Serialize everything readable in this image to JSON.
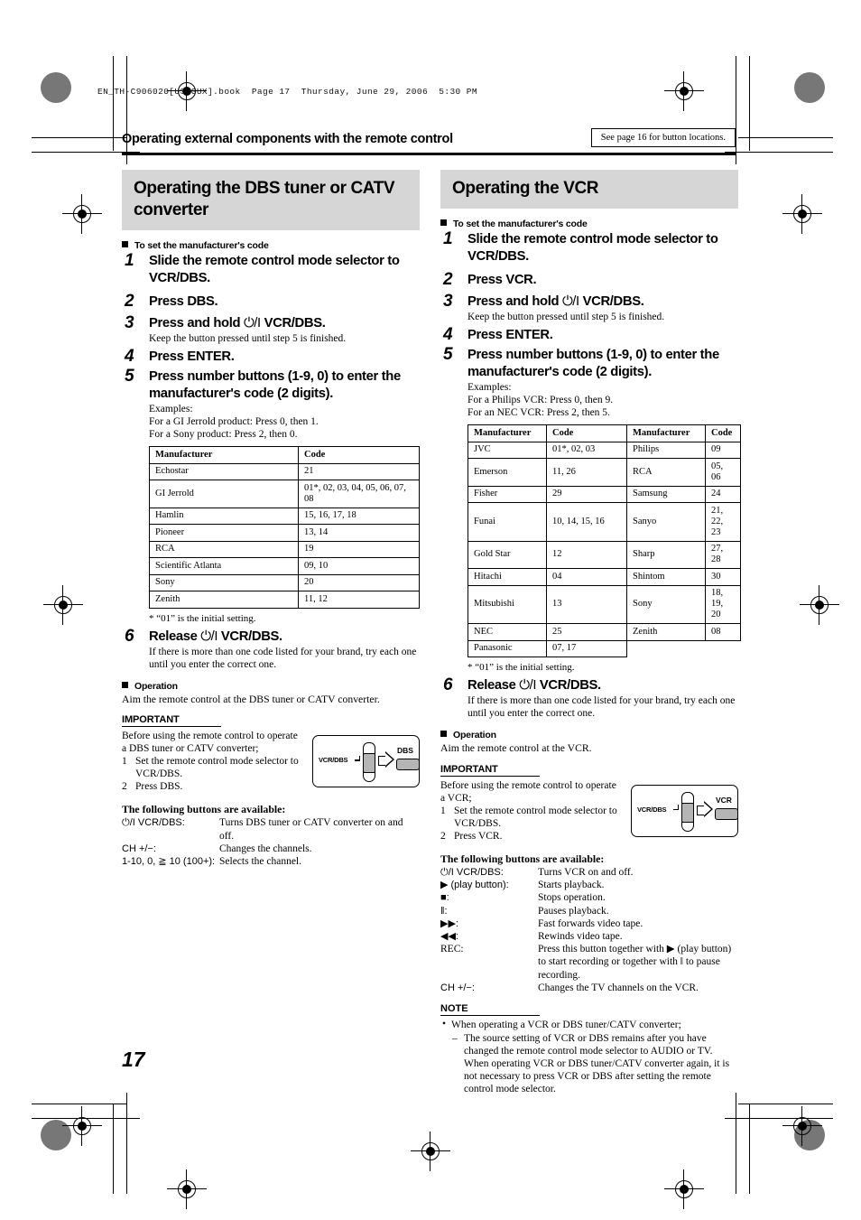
{
  "book_header": "EN_TH-C906020[USUGUX].book  Page 17  Thursday, June 29, 2006  5:30 PM",
  "running_head": {
    "title": "Operating external components with the remote control",
    "see_page_box": "See page 16 for button locations."
  },
  "page_number": "17",
  "left_column": {
    "section_title": "Operating the DBS tuner or CATV converter",
    "subhead": "To set the manufacturer's code",
    "steps": [
      {
        "num": "1",
        "title": "Slide the remote control mode selector to VCR/DBS.",
        "sub": ""
      },
      {
        "num": "2",
        "title": "Press DBS.",
        "sub": ""
      },
      {
        "num": "3",
        "title_pre": "Press and hold ",
        "power_glyph": "⏻/I",
        "title_post": " VCR/DBS.",
        "sub": "Keep the button pressed until step 5 is finished."
      },
      {
        "num": "4",
        "title": "Press ENTER.",
        "sub": ""
      },
      {
        "num": "5",
        "title": "Press number buttons (1-9, 0) to enter the manufacturer's code (2 digits).",
        "examples_label": "Examples:",
        "example_lines": [
          "For a GI Jerrold product: Press 0, then 1.",
          "For a Sony product: Press 2, then 0."
        ]
      }
    ],
    "table": {
      "headers": [
        "Manufacturer",
        "Code"
      ],
      "rows": [
        [
          "Echostar",
          "21"
        ],
        [
          "GI Jerrold",
          "01*, 02, 03, 04, 05, 06, 07, 08"
        ],
        [
          "Hamlin",
          "15, 16, 17, 18"
        ],
        [
          "Pioneer",
          "13, 14"
        ],
        [
          "RCA",
          "19"
        ],
        [
          "Scientific Atlanta",
          "09, 10"
        ],
        [
          "Sony",
          "20"
        ],
        [
          "Zenith",
          "11, 12"
        ]
      ]
    },
    "footnote": "* “01” is the initial setting.",
    "step6": {
      "num": "6",
      "title_pre": "Release ",
      "power_glyph": "⏻/I",
      "title_post": " VCR/DBS.",
      "sub": "If there is more than one code listed for your brand, try each one until you enter the correct one."
    },
    "operation_head": "Operation",
    "operation_body": "Aim the remote control at the DBS tuner or CATV converter.",
    "important_head": "IMPORTANT",
    "important_intro": "Before using the remote control to operate a DBS tuner or CATV converter;",
    "important_items": [
      {
        "n": "1",
        "t": "Set the remote control mode selector to VCR/DBS."
      },
      {
        "n": "2",
        "t": "Press DBS."
      }
    ],
    "diagram": {
      "selector_label": "VCR/DBS",
      "button_label": "DBS"
    },
    "buttons_head": "The following buttons are available:",
    "button_rows": [
      {
        "key": "⏻/I VCR/DBS:",
        "val": "Turns DBS tuner or CATV converter on and off."
      },
      {
        "key": "CH +/−:",
        "val": "Changes the channels."
      },
      {
        "key": "1-10, 0, ≧ 10 (100+):",
        "val": "Selects the channel."
      }
    ]
  },
  "right_column": {
    "section_title": "Operating the VCR",
    "subhead": "To set the manufacturer's code",
    "steps": [
      {
        "num": "1",
        "title": "Slide the remote control mode selector to VCR/DBS.",
        "sub": ""
      },
      {
        "num": "2",
        "title": "Press VCR.",
        "sub": ""
      },
      {
        "num": "3",
        "title_pre": "Press and hold ",
        "power_glyph": "⏻/I",
        "title_post": " VCR/DBS.",
        "sub": "Keep the button pressed until step 5 is finished."
      },
      {
        "num": "4",
        "title": "Press ENTER.",
        "sub": ""
      },
      {
        "num": "5",
        "title": "Press number buttons (1-9, 0) to enter the manufacturer's code (2 digits).",
        "examples_label": "Examples:",
        "example_lines": [
          "For a Philips VCR: Press 0, then 9.",
          "For an NEC VCR: Press 2, then 5."
        ]
      }
    ],
    "table": {
      "headers": [
        "Manufacturer",
        "Code",
        "Manufacturer",
        "Code"
      ],
      "rows": [
        [
          "JVC",
          "01*, 02, 03",
          "Philips",
          "09"
        ],
        [
          "Emerson",
          "11, 26",
          "RCA",
          "05, 06"
        ],
        [
          "Fisher",
          "29",
          "Samsung",
          "24"
        ],
        [
          "Funai",
          "10, 14, 15, 16",
          "Sanyo",
          "21, 22, 23"
        ],
        [
          "Gold Star",
          "12",
          "Sharp",
          "27, 28"
        ],
        [
          "Hitachi",
          "04",
          "Shintom",
          "30"
        ],
        [
          "Mitsubishi",
          "13",
          "Sony",
          "18, 19, 20"
        ],
        [
          "NEC",
          "25",
          "Zenith",
          "08"
        ],
        [
          "Panasonic",
          "07, 17",
          "",
          ""
        ]
      ]
    },
    "footnote": "* “01” is the initial setting.",
    "step6": {
      "num": "6",
      "title_pre": "Release ",
      "power_glyph": "⏻/I",
      "title_post": " VCR/DBS.",
      "sub": "If there is more than one code listed for your brand, try each one until you enter the correct one."
    },
    "operation_head": "Operation",
    "operation_body": "Aim the remote control at the VCR.",
    "important_head": "IMPORTANT",
    "important_intro": "Before using the remote control to operate a VCR;",
    "important_items": [
      {
        "n": "1",
        "t": "Set the remote control mode selector to VCR/DBS."
      },
      {
        "n": "2",
        "t": "Press VCR."
      }
    ],
    "diagram": {
      "selector_label": "VCR/DBS",
      "button_label": "VCR"
    },
    "buttons_head": "The following buttons are available:",
    "button_rows": [
      {
        "key": "⏻/I VCR/DBS:",
        "val": "Turns VCR on and off."
      },
      {
        "key": "▶ (play button):",
        "val": "Starts playback."
      },
      {
        "key": "■:",
        "val": "Stops operation."
      },
      {
        "key": "‖:",
        "val": "Pauses playback."
      },
      {
        "key": "▶▶:",
        "val": "Fast forwards video tape."
      },
      {
        "key": "◀◀:",
        "val": "Rewinds video tape."
      },
      {
        "key": "REC:",
        "val": "Press this button together with ▶ (play button) to start recording or together with ‖ to pause recording."
      },
      {
        "key": "CH +/−:",
        "val": "Changes the TV channels on the VCR."
      }
    ],
    "note_head": "NOTE",
    "note_bullet": "When operating a VCR or DBS tuner/CATV converter;",
    "note_dash": "The source setting of VCR or DBS remains after you have changed the remote control mode selector to AUDIO or TV. When operating VCR or DBS tuner/CATV converter again, it is not necessary to press VCR or DBS after setting the remote control mode selector."
  }
}
